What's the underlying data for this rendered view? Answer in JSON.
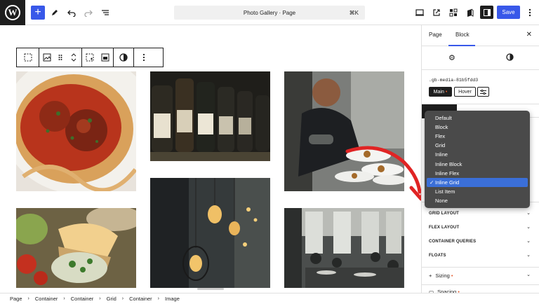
{
  "topbar": {
    "document_title": "Photo Gallery · Page",
    "shortcut": "⌘K",
    "save_label": "Save"
  },
  "sidebar": {
    "tabs": [
      "Page",
      "Block"
    ],
    "active_tab": "Block",
    "selector": ".gb-media-81b5fdd3",
    "states": [
      "Main",
      "Hover"
    ],
    "active_state": "Main",
    "sections": [
      "GRID LAYOUT",
      "FLEX LAYOUT",
      "CONTAINER QUERIES",
      "FLOATS"
    ],
    "panels": [
      {
        "label": "Sizing"
      },
      {
        "label": "Spacing"
      }
    ]
  },
  "display_dropdown": {
    "options": [
      "Default",
      "Block",
      "Flex",
      "Grid",
      "Inline",
      "Inline Block",
      "Inline Flex",
      "Inline Grid",
      "List Item",
      "None"
    ],
    "selected": "Inline Grid",
    "check": "✓"
  },
  "breadcrumb": [
    "Page",
    "Container",
    "Container",
    "Grid",
    "Container",
    "Image"
  ],
  "colors": {
    "accent": "#3858e9",
    "dropdown_bg": "#4a4a4a",
    "dropdown_selected": "#3b6fd8",
    "annotation_arrow": "#e02424"
  },
  "gallery": {
    "images": [
      "spaghetti-meatballs",
      "wine-bottles",
      "chef-plating",
      "pendant-lights",
      "sandwich",
      "restaurant-terrace"
    ]
  }
}
